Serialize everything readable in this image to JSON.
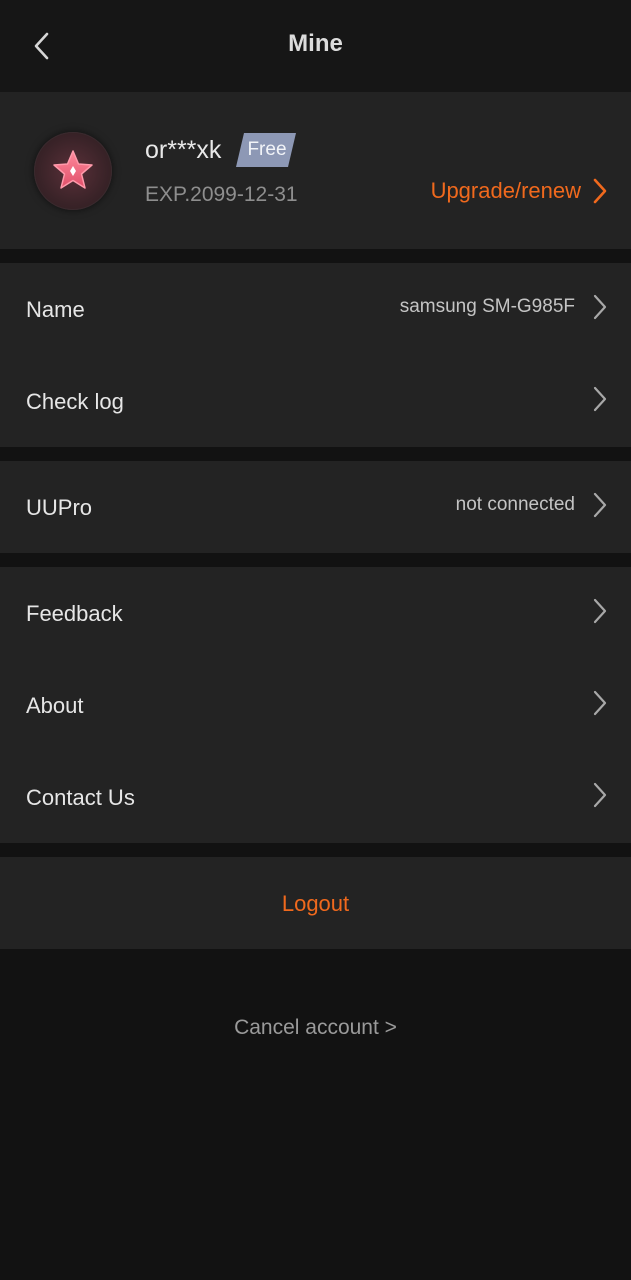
{
  "header": {
    "back_icon": "chevron-left-icon",
    "title": "Mine"
  },
  "profile": {
    "avatar_icon": "star-icon",
    "username": "or***xk",
    "plan_badge": "Free",
    "expiry": "EXP.2099-12-31",
    "upgrade_label": "Upgrade/renew",
    "accent_color": "#f0691d"
  },
  "settings": {
    "name": {
      "label": "Name",
      "value": "samsung SM-G985F"
    },
    "check_log": {
      "label": "Check log"
    },
    "uupro": {
      "label": "UUPro",
      "value": "not connected"
    },
    "feedback": {
      "label": "Feedback"
    },
    "about": {
      "label": "About"
    },
    "contact_us": {
      "label": "Contact Us"
    }
  },
  "logout_label": "Logout",
  "cancel_account_label": "Cancel account >"
}
